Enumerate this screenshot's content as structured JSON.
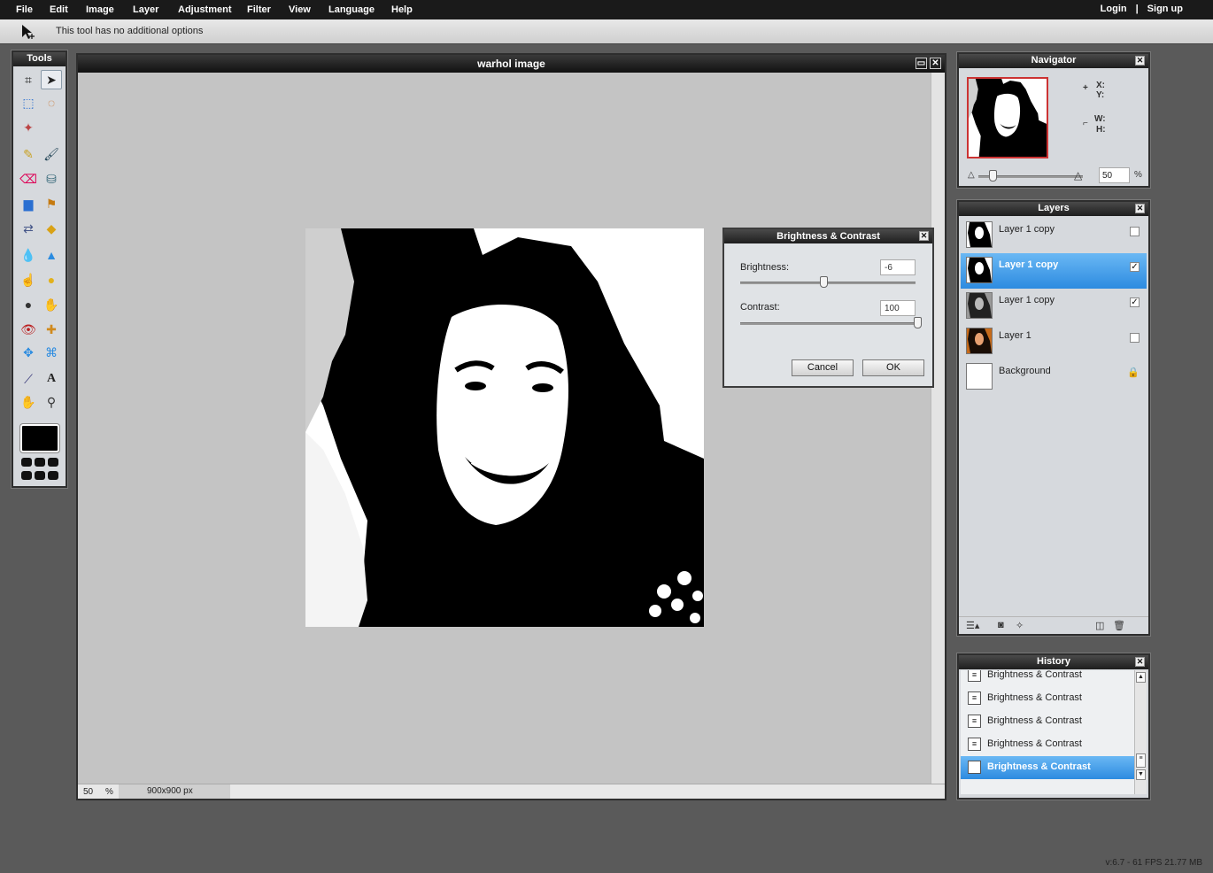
{
  "menubar": {
    "items": [
      "File",
      "Edit",
      "Image",
      "Layer",
      "Adjustment",
      "Filter",
      "View",
      "Language",
      "Help"
    ],
    "login": "Login",
    "separator": "|",
    "signup": "Sign up"
  },
  "options": {
    "text": "This tool has no additional options"
  },
  "tools": {
    "title": "Tools"
  },
  "image_window": {
    "title": "warhol image",
    "zoom": "50",
    "zoom_unit": "%",
    "size": "900x900 px"
  },
  "dialog": {
    "title": "Brightness & Contrast",
    "brightness_label": "Brightness:",
    "brightness_value": "-6",
    "contrast_label": "Contrast:",
    "contrast_value": "100",
    "cancel": "Cancel",
    "ok": "OK"
  },
  "navigator": {
    "title": "Navigator",
    "x_label": "X:",
    "y_label": "Y:",
    "w_label": "W:",
    "h_label": "H:",
    "zoom": "50",
    "zoom_unit": "%"
  },
  "layers": {
    "title": "Layers",
    "items": [
      {
        "name": "Layer 1 copy",
        "visible": false,
        "selected": false
      },
      {
        "name": "Layer 1 copy",
        "visible": true,
        "selected": true
      },
      {
        "name": "Layer 1 copy",
        "visible": true,
        "selected": false
      },
      {
        "name": "Layer 1",
        "visible": false,
        "selected": false
      },
      {
        "name": "Background",
        "locked": true,
        "selected": false
      }
    ]
  },
  "history": {
    "title": "History",
    "items": [
      "Brightness & Contrast",
      "Brightness & Contrast",
      "Brightness & Contrast",
      "Brightness & Contrast",
      "Brightness & Contrast"
    ]
  },
  "footer": {
    "version": "v:6.7 - 61 FPS 21.77 MB"
  },
  "colors": {
    "selection": "#2d8be0",
    "chrome": "#1e1e1e",
    "panel": "#d6d9dd"
  }
}
